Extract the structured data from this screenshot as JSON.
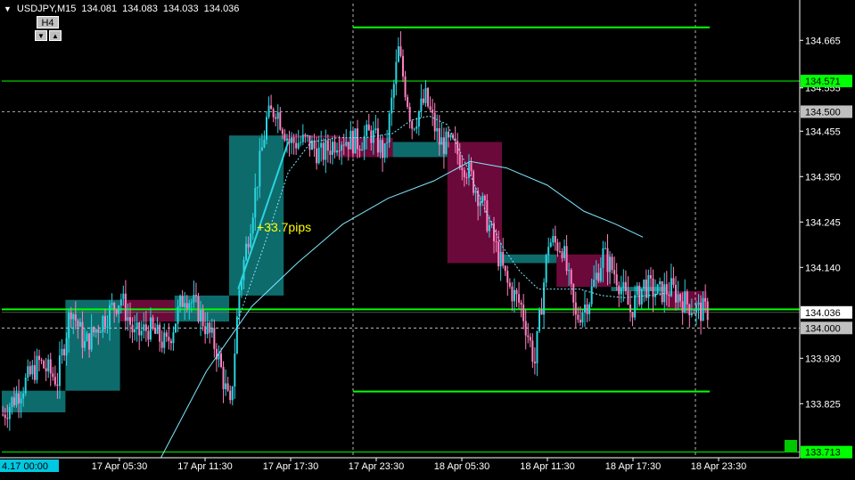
{
  "header": {
    "symbol_tf": "USDJPY,M15",
    "open": "134.081",
    "high": "134.083",
    "low": "134.033",
    "close": "134.036",
    "timeframe_button": "H4"
  },
  "chart_data": {
    "type": "candlestick",
    "symbol": "USDJPY",
    "timeframe": "M15",
    "ylim": [
      133.7,
      134.75
    ],
    "y_ticks": [
      "134.665",
      "134.555",
      "134.455",
      "134.350",
      "134.245",
      "134.140",
      "134.036",
      "133.930",
      "133.825"
    ],
    "y_tick_values": [
      134.665,
      134.555,
      134.455,
      134.35,
      134.245,
      134.14,
      134.036,
      133.93,
      133.825
    ],
    "x_ticks": [
      "17 Apr 05:30",
      "17 Apr 11:30",
      "17 Apr 17:30",
      "17 Apr 23:30",
      "18 Apr 05:30",
      "18 Apr 11:30",
      "18 Apr 17:30",
      "18 Apr 23:30"
    ],
    "x_left_label": "4.17 00:00",
    "price_tags": [
      {
        "label": "134.571",
        "value": 134.571,
        "color": "#00ff00",
        "text_color": "#000000"
      },
      {
        "label": "134.500",
        "value": 134.5,
        "color": "#c0c0c0",
        "text_color": "#000000"
      },
      {
        "label": "134.036",
        "value": 134.036,
        "color": "#ffffff",
        "text_color": "#000000"
      },
      {
        "label": "134.000",
        "value": 134.0,
        "color": "#c0c0c0",
        "text_color": "#000000"
      },
      {
        "label": "133.713",
        "value": 133.713,
        "color": "#00ff00",
        "text_color": "#000000"
      }
    ],
    "annotation": {
      "text": "+33.7pips",
      "color": "#ffff00"
    },
    "horizontal_levels": [
      134.571,
      134.043,
      133.713
    ],
    "range_box_levels": [
      134.695,
      133.853
    ],
    "h4_blocks": [
      {
        "start": 0,
        "end": 28,
        "open": 133.805,
        "close": 133.855,
        "color": "#0e6b6b"
      },
      {
        "start": 28,
        "end": 52,
        "open": 133.855,
        "close": 134.065,
        "color": "#0e6b6b"
      },
      {
        "start": 52,
        "end": 76,
        "open": 134.065,
        "close": 134.015,
        "color": "#6b0a3a"
      },
      {
        "start": 76,
        "end": 100,
        "open": 134.015,
        "close": 134.075,
        "color": "#0e6b6b"
      },
      {
        "start": 100,
        "end": 124,
        "open": 134.075,
        "close": 134.445,
        "color": "#0e6b6b"
      },
      {
        "start": 124,
        "end": 148,
        "open": 134.445,
        "close": 134.44,
        "color": "#6b0a3a"
      },
      {
        "start": 148,
        "end": 172,
        "open": 134.44,
        "close": 134.395,
        "color": "#6b0a3a"
      },
      {
        "start": 172,
        "end": 196,
        "open": 134.395,
        "close": 134.43,
        "color": "#0e6b6b"
      },
      {
        "start": 196,
        "end": 220,
        "open": 134.43,
        "close": 134.15,
        "color": "#6b0a3a"
      },
      {
        "start": 220,
        "end": 244,
        "open": 134.15,
        "close": 134.17,
        "color": "#0e6b6b"
      },
      {
        "start": 244,
        "end": 268,
        "open": 134.17,
        "close": 134.095,
        "color": "#6b0a3a"
      },
      {
        "start": 268,
        "end": 292,
        "open": 134.095,
        "close": 134.085,
        "color": "#0e6b6b"
      },
      {
        "start": 292,
        "end": 310,
        "open": 134.085,
        "close": 134.04,
        "color": "#6b0a3a"
      }
    ],
    "candle_path": [
      [
        0,
        133.8
      ],
      [
        8,
        133.86
      ],
      [
        16,
        133.92
      ],
      [
        24,
        133.88
      ],
      [
        30,
        134.05
      ],
      [
        36,
        133.96
      ],
      [
        44,
        134.02
      ],
      [
        52,
        134.07
      ],
      [
        58,
        133.98
      ],
      [
        64,
        134.0
      ],
      [
        72,
        133.96
      ],
      [
        80,
        134.08
      ],
      [
        86,
        134.04
      ],
      [
        94,
        133.95
      ],
      [
        100,
        133.81
      ],
      [
        104,
        134.09
      ],
      [
        110,
        134.28
      ],
      [
        116,
        134.48
      ],
      [
        120,
        134.51
      ],
      [
        126,
        134.43
      ],
      [
        134,
        134.43
      ],
      [
        140,
        134.4
      ],
      [
        148,
        134.44
      ],
      [
        156,
        134.43
      ],
      [
        162,
        134.45
      ],
      [
        168,
        134.4
      ],
      [
        174,
        134.64
      ],
      [
        180,
        134.47
      ],
      [
        186,
        134.53
      ],
      [
        192,
        134.43
      ],
      [
        198,
        134.42
      ],
      [
        204,
        134.37
      ],
      [
        210,
        134.3
      ],
      [
        216,
        134.2
      ],
      [
        222,
        134.1
      ],
      [
        228,
        134.05
      ],
      [
        234,
        133.92
      ],
      [
        240,
        134.2
      ],
      [
        246,
        134.19
      ],
      [
        252,
        134.02
      ],
      [
        258,
        134.07
      ],
      [
        264,
        134.17
      ],
      [
        270,
        134.12
      ],
      [
        276,
        134.04
      ],
      [
        282,
        134.1
      ],
      [
        288,
        134.08
      ],
      [
        294,
        134.09
      ],
      [
        300,
        134.06
      ],
      [
        306,
        134.04
      ]
    ],
    "ma_slow": [
      [
        70,
        133.7
      ],
      [
        90,
        133.9
      ],
      [
        110,
        134.05
      ],
      [
        130,
        134.15
      ],
      [
        150,
        134.24
      ],
      [
        170,
        134.3
      ],
      [
        190,
        134.34
      ],
      [
        206,
        134.385
      ],
      [
        222,
        134.37
      ],
      [
        240,
        134.33
      ],
      [
        256,
        134.27
      ],
      [
        270,
        134.24
      ],
      [
        282,
        134.21
      ]
    ],
    "ma_fast": [
      [
        104,
        134.02
      ],
      [
        116,
        134.2
      ],
      [
        126,
        134.36
      ],
      [
        136,
        134.43
      ],
      [
        148,
        134.44
      ],
      [
        160,
        134.44
      ],
      [
        172,
        134.45
      ],
      [
        180,
        134.48
      ],
      [
        188,
        134.49
      ],
      [
        196,
        134.47
      ],
      [
        204,
        134.38
      ],
      [
        212,
        134.28
      ],
      [
        220,
        134.19
      ],
      [
        228,
        134.13
      ],
      [
        236,
        134.09
      ],
      [
        244,
        134.09
      ],
      [
        254,
        134.09
      ],
      [
        264,
        134.075
      ],
      [
        274,
        134.07
      ],
      [
        284,
        134.075
      ],
      [
        292,
        134.08
      ]
    ]
  }
}
